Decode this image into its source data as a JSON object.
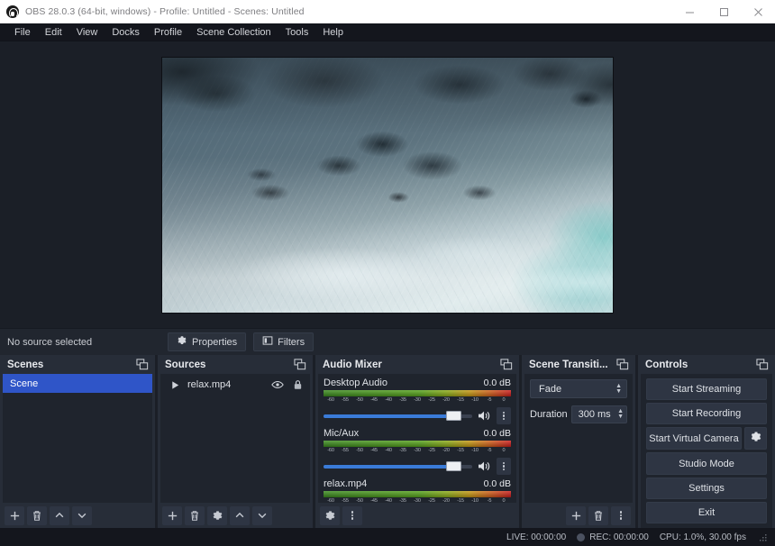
{
  "window": {
    "title": "OBS 28.0.3 (64-bit, windows) - Profile: Untitled - Scenes: Untitled",
    "logo_icon": "obs-logo-icon",
    "minimize_icon": "minimize-icon",
    "maximize_icon": "maximize-icon",
    "close_icon": "close-icon"
  },
  "menubar": {
    "items": [
      {
        "label": "File"
      },
      {
        "label": "Edit"
      },
      {
        "label": "View"
      },
      {
        "label": "Docks"
      },
      {
        "label": "Profile"
      },
      {
        "label": "Scene Collection"
      },
      {
        "label": "Tools"
      },
      {
        "label": "Help"
      }
    ]
  },
  "preview": {
    "description": "Aerial view of rocky coastline with white surf and turquoise ocean water"
  },
  "source_toolbar": {
    "status_label": "No source selected",
    "properties_label": "Properties",
    "properties_icon": "gear-icon",
    "filters_label": "Filters",
    "filters_icon": "filters-icon"
  },
  "scenes": {
    "title": "Scenes",
    "popout_icon": "undock-icon",
    "items": [
      {
        "label": "Scene",
        "selected": true
      }
    ],
    "buttons": [
      {
        "name": "add-scene-button",
        "icon": "plus-icon"
      },
      {
        "name": "remove-scene-button",
        "icon": "trash-icon"
      },
      {
        "name": "move-scene-up-button",
        "icon": "chevron-up-icon"
      },
      {
        "name": "move-scene-down-button",
        "icon": "chevron-down-icon"
      }
    ]
  },
  "sources": {
    "title": "Sources",
    "popout_icon": "undock-icon",
    "items": [
      {
        "label": "relax.mp4",
        "type_icon": "media-play-icon",
        "visible_icon": "eye-icon",
        "lock_icon": "lock-icon"
      }
    ],
    "buttons": [
      {
        "name": "add-source-button",
        "icon": "plus-icon"
      },
      {
        "name": "remove-source-button",
        "icon": "trash-icon"
      },
      {
        "name": "source-properties-button",
        "icon": "gear-icon"
      },
      {
        "name": "move-source-up-button",
        "icon": "chevron-up-icon"
      },
      {
        "name": "move-source-down-button",
        "icon": "chevron-down-icon"
      }
    ]
  },
  "audio_mixer": {
    "title": "Audio Mixer",
    "popout_icon": "undock-icon",
    "scale_ticks": [
      "-60",
      "-55",
      "-50",
      "-45",
      "-40",
      "-35",
      "-30",
      "-25",
      "-20",
      "-15",
      "-10",
      "-5",
      "0"
    ],
    "channels": [
      {
        "name": "Desktop Audio",
        "db": "0.0 dB",
        "volume_percent": 88,
        "mute_icon": "speaker-icon",
        "menu_icon": "vertical-dots-icon"
      },
      {
        "name": "Mic/Aux",
        "db": "0.0 dB",
        "volume_percent": 88,
        "mute_icon": "speaker-icon",
        "menu_icon": "vertical-dots-icon"
      },
      {
        "name": "relax.mp4",
        "db": "0.0 dB",
        "volume_percent": 88,
        "mute_icon": "speaker-icon",
        "menu_icon": "vertical-dots-icon"
      }
    ],
    "buttons": [
      {
        "name": "audio-settings-button",
        "icon": "gear-icon"
      },
      {
        "name": "audio-menu-button",
        "icon": "vertical-dots-icon"
      }
    ]
  },
  "scene_transitions": {
    "title": "Scene Transiti...",
    "popout_icon": "undock-icon",
    "transition": "Fade",
    "duration_label": "Duration",
    "duration_value": "300 ms",
    "buttons": [
      {
        "name": "add-transition-button",
        "icon": "plus-icon"
      },
      {
        "name": "remove-transition-button",
        "icon": "trash-icon"
      },
      {
        "name": "transition-menu-button",
        "icon": "vertical-dots-icon"
      }
    ]
  },
  "controls": {
    "title": "Controls",
    "popout_icon": "undock-icon",
    "start_streaming": "Start Streaming",
    "start_recording": "Start Recording",
    "start_virtual_camera": "Start Virtual Camera",
    "virtual_camera_settings_icon": "gear-icon",
    "studio_mode": "Studio Mode",
    "settings": "Settings",
    "exit": "Exit"
  },
  "statusbar": {
    "live": "LIVE: 00:00:00",
    "rec": "REC: 00:00:00",
    "cpu": "CPU: 1.0%, 30.00 fps",
    "rec_indicator_icon": "record-disk-icon",
    "resize-grip_icon": "resize-grip-icon"
  }
}
